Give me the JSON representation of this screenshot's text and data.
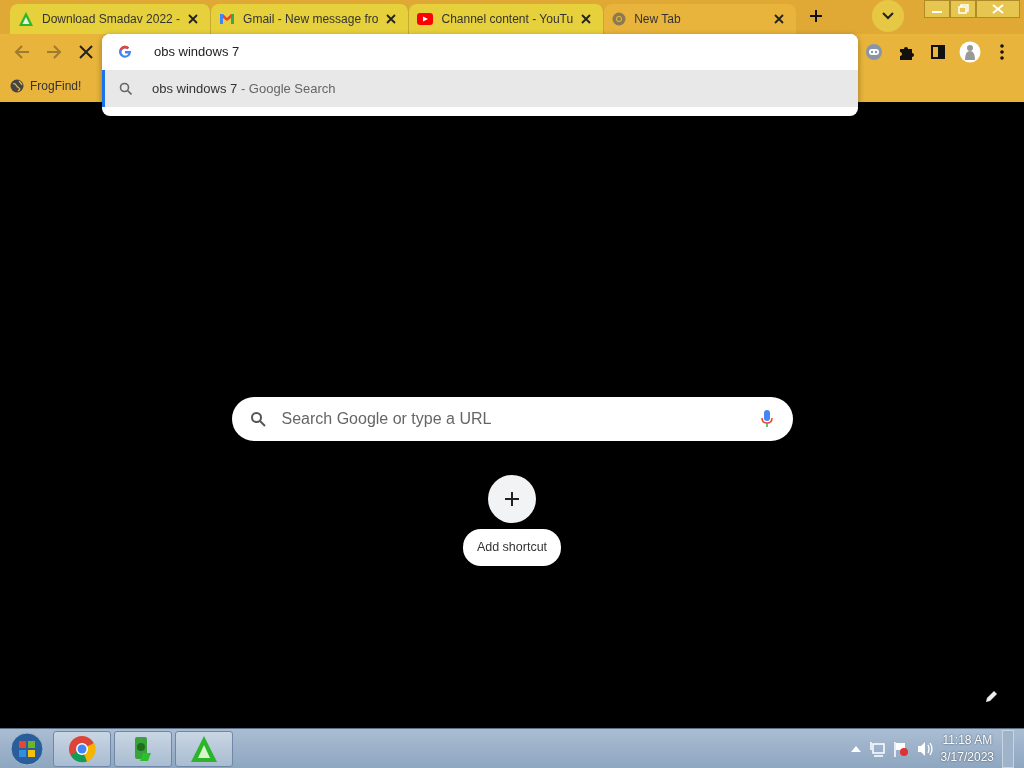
{
  "tabs": [
    {
      "title": "Download Smadav 2022 -",
      "selected": false
    },
    {
      "title": "Gmail - New message fro",
      "selected": false
    },
    {
      "title": "Channel content - YouTu",
      "selected": false
    },
    {
      "title": "New Tab",
      "selected": true
    }
  ],
  "omnibox": {
    "value": "obs windows 7",
    "suggestions": [
      {
        "query": "obs windows 7",
        "suffix": "- Google Search",
        "selected": true
      }
    ]
  },
  "bookmarks": [
    {
      "label": "FrogFind!"
    }
  ],
  "ntp": {
    "search_placeholder": "Search Google or type a URL",
    "shortcut_label": "Add shortcut"
  },
  "taskbar": {
    "apps": [
      {
        "kind": "chrome"
      },
      {
        "kind": "green"
      },
      {
        "kind": "smadav"
      }
    ],
    "time": "11:18 AM",
    "date": "3/17/2023"
  }
}
